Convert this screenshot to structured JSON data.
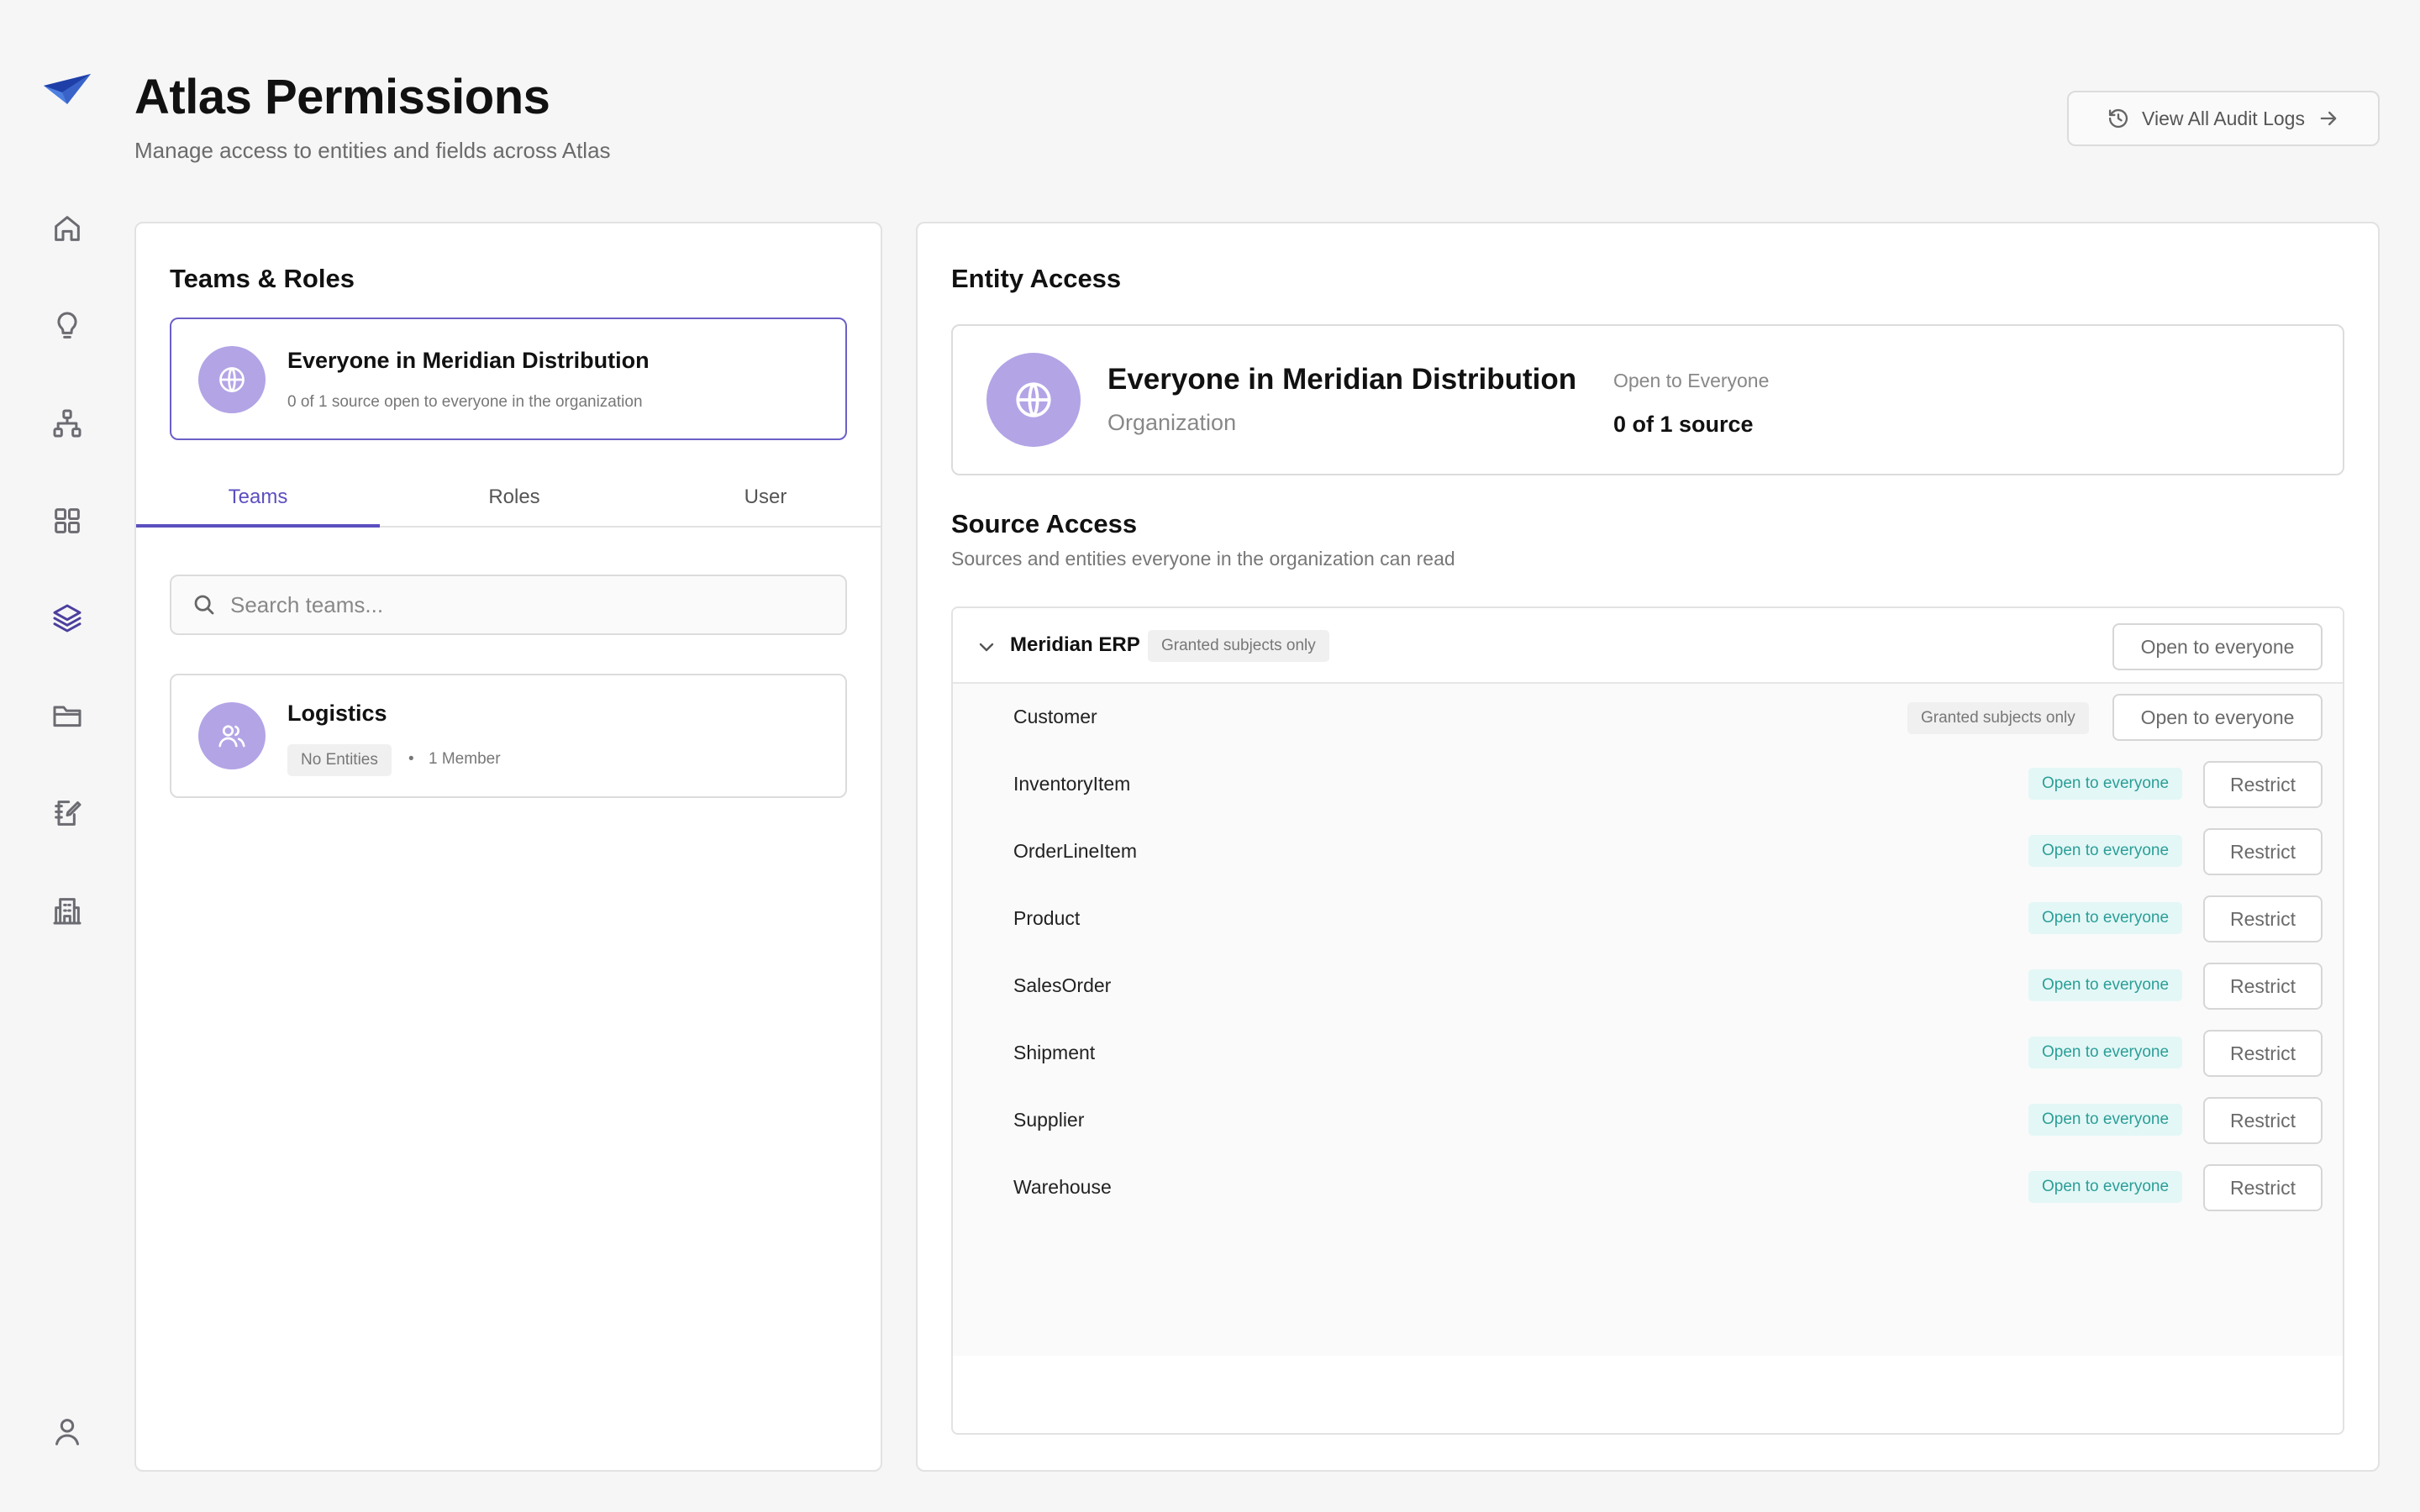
{
  "app": {
    "title": "Atlas Permissions",
    "subtitle": "Manage access to entities and fields across Atlas",
    "audit_button": "View All Audit Logs"
  },
  "sidebar": {
    "items": [
      {
        "name": "home-icon"
      },
      {
        "name": "lightbulb-icon"
      },
      {
        "name": "hierarchy-icon"
      },
      {
        "name": "grid-icon"
      },
      {
        "name": "layers-icon",
        "active": true
      },
      {
        "name": "folder-icon"
      },
      {
        "name": "notebook-edit-icon"
      },
      {
        "name": "building-icon"
      }
    ],
    "bottom": {
      "name": "user-icon"
    }
  },
  "left_panel": {
    "title": "Teams & Roles",
    "everyone": {
      "name": "Everyone in Meridian Distribution",
      "description": "0 of 1 source open to everyone in the organization"
    },
    "tabs": [
      {
        "label": "Teams",
        "active": true
      },
      {
        "label": "Roles",
        "active": false
      },
      {
        "label": "User",
        "active": false
      }
    ],
    "search": {
      "placeholder": "Search teams...",
      "value": ""
    },
    "teams": [
      {
        "name": "Logistics",
        "entities": "No Entities",
        "members": "1 Member"
      }
    ]
  },
  "right_panel": {
    "title": "Entity Access",
    "entity": {
      "name": "Everyone in Meridian Distribution",
      "type": "Organization",
      "status_label": "Open to Everyone",
      "status_value": "0 of 1 source"
    },
    "source_access": {
      "title": "Source Access",
      "subtitle": "Sources and entities everyone in the organization can read",
      "source": {
        "name": "Meridian ERP",
        "badge": "Granted subjects only",
        "action": "Open to everyone"
      },
      "entities": [
        {
          "name": "Customer",
          "badge": "Granted subjects only",
          "badge_style": "gray",
          "action": "Open to everyone"
        },
        {
          "name": "InventoryItem",
          "badge": "Open to everyone",
          "badge_style": "teal",
          "action": "Restrict"
        },
        {
          "name": "OrderLineItem",
          "badge": "Open to everyone",
          "badge_style": "teal",
          "action": "Restrict"
        },
        {
          "name": "Product",
          "badge": "Open to everyone",
          "badge_style": "teal",
          "action": "Restrict"
        },
        {
          "name": "SalesOrder",
          "badge": "Open to everyone",
          "badge_style": "teal",
          "action": "Restrict"
        },
        {
          "name": "Shipment",
          "badge": "Open to everyone",
          "badge_style": "teal",
          "action": "Restrict"
        },
        {
          "name": "Supplier",
          "badge": "Open to everyone",
          "badge_style": "teal",
          "action": "Restrict"
        },
        {
          "name": "Warehouse",
          "badge": "Open to everyone",
          "badge_style": "teal",
          "action": "Restrict"
        }
      ]
    }
  },
  "colors": {
    "accent": "#5b4fc0",
    "avatar": "#b3a4e6",
    "teal_badge_bg": "#e3f7f6",
    "teal_badge_text": "#2a9e97",
    "logo_dark": "#1f3fa8",
    "logo_light": "#4c7fe0"
  }
}
